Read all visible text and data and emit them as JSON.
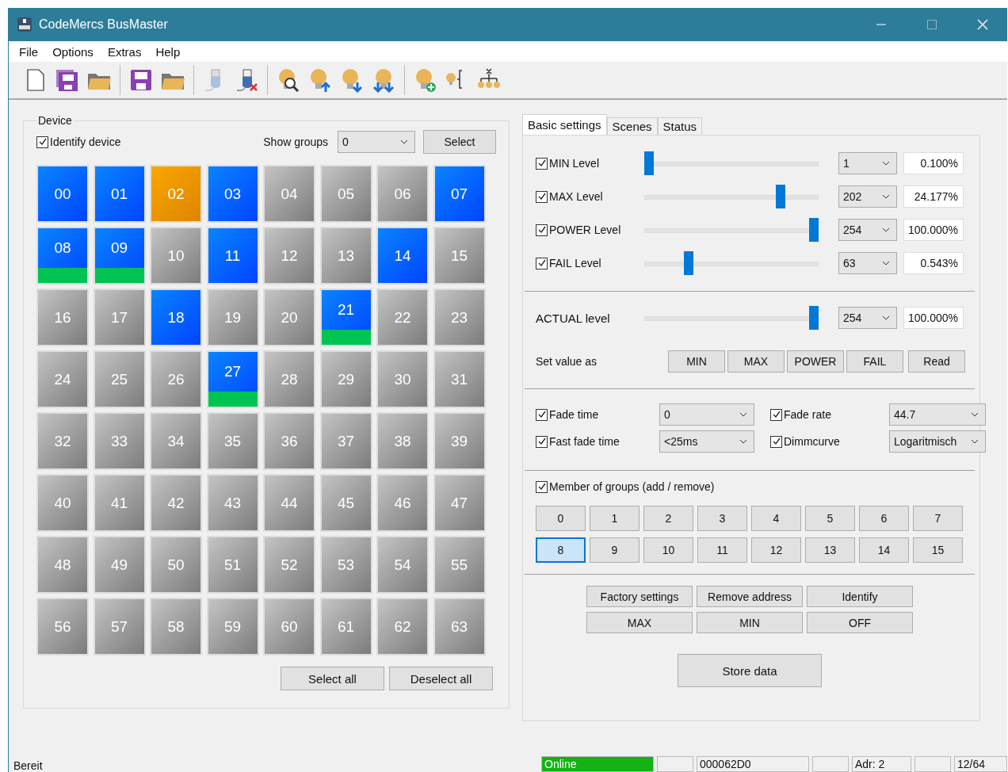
{
  "window": {
    "title": "CodeMercs BusMaster"
  },
  "menu": [
    "File",
    "Options",
    "Extras",
    "Help"
  ],
  "device_panel": {
    "title": "Device",
    "identify": {
      "label": "Identify device",
      "checked": true
    },
    "show_groups_label": "Show groups",
    "show_groups_value": "0",
    "select_button": "Select",
    "tiles": [
      {
        "label": "00",
        "online": true,
        "selected": false,
        "marked": false
      },
      {
        "label": "01",
        "online": true,
        "selected": false,
        "marked": false
      },
      {
        "label": "02",
        "online": true,
        "selected": true,
        "marked": false
      },
      {
        "label": "03",
        "online": true,
        "selected": false,
        "marked": false
      },
      {
        "label": "04",
        "online": false,
        "selected": false,
        "marked": false
      },
      {
        "label": "05",
        "online": false,
        "selected": false,
        "marked": false
      },
      {
        "label": "06",
        "online": false,
        "selected": false,
        "marked": false
      },
      {
        "label": "07",
        "online": true,
        "selected": false,
        "marked": false
      },
      {
        "label": "08",
        "online": true,
        "selected": false,
        "marked": true
      },
      {
        "label": "09",
        "online": true,
        "selected": false,
        "marked": true
      },
      {
        "label": "10",
        "online": false,
        "selected": false,
        "marked": false
      },
      {
        "label": "11",
        "online": true,
        "selected": false,
        "marked": false
      },
      {
        "label": "12",
        "online": false,
        "selected": false,
        "marked": false
      },
      {
        "label": "13",
        "online": false,
        "selected": false,
        "marked": false
      },
      {
        "label": "14",
        "online": true,
        "selected": false,
        "marked": false
      },
      {
        "label": "15",
        "online": false,
        "selected": false,
        "marked": false
      },
      {
        "label": "16",
        "online": false,
        "selected": false,
        "marked": false
      },
      {
        "label": "17",
        "online": false,
        "selected": false,
        "marked": false
      },
      {
        "label": "18",
        "online": true,
        "selected": false,
        "marked": false
      },
      {
        "label": "19",
        "online": false,
        "selected": false,
        "marked": false
      },
      {
        "label": "20",
        "online": false,
        "selected": false,
        "marked": false
      },
      {
        "label": "21",
        "online": true,
        "selected": false,
        "marked": true
      },
      {
        "label": "22",
        "online": false,
        "selected": false,
        "marked": false
      },
      {
        "label": "23",
        "online": false,
        "selected": false,
        "marked": false
      },
      {
        "label": "24",
        "online": false,
        "selected": false,
        "marked": false
      },
      {
        "label": "25",
        "online": false,
        "selected": false,
        "marked": false
      },
      {
        "label": "26",
        "online": false,
        "selected": false,
        "marked": false
      },
      {
        "label": "27",
        "online": true,
        "selected": false,
        "marked": true
      },
      {
        "label": "28",
        "online": false,
        "selected": false,
        "marked": false
      },
      {
        "label": "29",
        "online": false,
        "selected": false,
        "marked": false
      },
      {
        "label": "30",
        "online": false,
        "selected": false,
        "marked": false
      },
      {
        "label": "31",
        "online": false,
        "selected": false,
        "marked": false
      },
      {
        "label": "32",
        "online": false,
        "selected": false,
        "marked": false
      },
      {
        "label": "33",
        "online": false,
        "selected": false,
        "marked": false
      },
      {
        "label": "34",
        "online": false,
        "selected": false,
        "marked": false
      },
      {
        "label": "35",
        "online": false,
        "selected": false,
        "marked": false
      },
      {
        "label": "36",
        "online": false,
        "selected": false,
        "marked": false
      },
      {
        "label": "37",
        "online": false,
        "selected": false,
        "marked": false
      },
      {
        "label": "38",
        "online": false,
        "selected": false,
        "marked": false
      },
      {
        "label": "39",
        "online": false,
        "selected": false,
        "marked": false
      },
      {
        "label": "40",
        "online": false,
        "selected": false,
        "marked": false
      },
      {
        "label": "41",
        "online": false,
        "selected": false,
        "marked": false
      },
      {
        "label": "42",
        "online": false,
        "selected": false,
        "marked": false
      },
      {
        "label": "43",
        "online": false,
        "selected": false,
        "marked": false
      },
      {
        "label": "44",
        "online": false,
        "selected": false,
        "marked": false
      },
      {
        "label": "45",
        "online": false,
        "selected": false,
        "marked": false
      },
      {
        "label": "46",
        "online": false,
        "selected": false,
        "marked": false
      },
      {
        "label": "47",
        "online": false,
        "selected": false,
        "marked": false
      },
      {
        "label": "48",
        "online": false,
        "selected": false,
        "marked": false
      },
      {
        "label": "49",
        "online": false,
        "selected": false,
        "marked": false
      },
      {
        "label": "50",
        "online": false,
        "selected": false,
        "marked": false
      },
      {
        "label": "51",
        "online": false,
        "selected": false,
        "marked": false
      },
      {
        "label": "52",
        "online": false,
        "selected": false,
        "marked": false
      },
      {
        "label": "53",
        "online": false,
        "selected": false,
        "marked": false
      },
      {
        "label": "54",
        "online": false,
        "selected": false,
        "marked": false
      },
      {
        "label": "55",
        "online": false,
        "selected": false,
        "marked": false
      },
      {
        "label": "56",
        "online": false,
        "selected": false,
        "marked": false
      },
      {
        "label": "57",
        "online": false,
        "selected": false,
        "marked": false
      },
      {
        "label": "58",
        "online": false,
        "selected": false,
        "marked": false
      },
      {
        "label": "59",
        "online": false,
        "selected": false,
        "marked": false
      },
      {
        "label": "60",
        "online": false,
        "selected": false,
        "marked": false
      },
      {
        "label": "61",
        "online": false,
        "selected": false,
        "marked": false
      },
      {
        "label": "62",
        "online": false,
        "selected": false,
        "marked": false
      },
      {
        "label": "63",
        "online": false,
        "selected": false,
        "marked": false
      }
    ],
    "buttons": [
      "Select all",
      "Deselect all"
    ]
  },
  "tabs": [
    {
      "label": "Basic settings",
      "selected": true
    },
    {
      "label": "Scenes",
      "selected": false
    },
    {
      "label": "Status",
      "selected": false
    }
  ],
  "levels": [
    {
      "label": "MIN Level",
      "checked": true,
      "level": 0.0,
      "value": "1",
      "percent": "0.100%"
    },
    {
      "label": "MAX Level",
      "checked": true,
      "level": 0.8,
      "value": "202",
      "percent": "24.177%"
    },
    {
      "label": "POWER Level",
      "checked": true,
      "level": 1.0,
      "value": "254",
      "percent": "100.000%"
    },
    {
      "label": "FAIL Level",
      "checked": true,
      "level": 0.24,
      "value": "63",
      "percent": "0.543%"
    }
  ],
  "actual": {
    "label": "ACTUAL level",
    "level": 1.0,
    "value": "254",
    "percent": "100.000%"
  },
  "set_value": {
    "label": "Set value as",
    "buttons": [
      "MIN",
      "MAX",
      "POWER",
      "FAIL"
    ],
    "read_button": "Read"
  },
  "fade": [
    {
      "label": "Fade time",
      "checked": true,
      "value": "0"
    },
    {
      "label": "Fade rate",
      "checked": true,
      "value": "44.7"
    },
    {
      "label": "Fast fade time",
      "checked": true,
      "value": "<25ms"
    },
    {
      "label": "Dimmcurve",
      "checked": true,
      "value": "Logaritmisch"
    }
  ],
  "groups": {
    "label": "Member of groups (add / remove)",
    "checked": true,
    "items": [
      {
        "label": "0",
        "selected": false
      },
      {
        "label": "1",
        "selected": false
      },
      {
        "label": "2",
        "selected": false
      },
      {
        "label": "3",
        "selected": false
      },
      {
        "label": "4",
        "selected": false
      },
      {
        "label": "5",
        "selected": false
      },
      {
        "label": "6",
        "selected": false
      },
      {
        "label": "7",
        "selected": false
      },
      {
        "label": "8",
        "selected": true
      },
      {
        "label": "9",
        "selected": false
      },
      {
        "label": "10",
        "selected": false
      },
      {
        "label": "11",
        "selected": false
      },
      {
        "label": "12",
        "selected": false
      },
      {
        "label": "13",
        "selected": false
      },
      {
        "label": "14",
        "selected": false
      },
      {
        "label": "15",
        "selected": false
      }
    ]
  },
  "actions": [
    "Factory settings",
    "Remove address",
    "Identify",
    "MAX",
    "MIN",
    "OFF"
  ],
  "store_button": "Store data",
  "status_bar": {
    "text": "Bereit",
    "panels": [
      {
        "text": "Online",
        "kind": "online"
      },
      {
        "kind": "empty"
      },
      {
        "text": "000062D0",
        "kind": "plain"
      },
      {
        "kind": "empty"
      },
      {
        "text": "Adr: 2",
        "kind": "plain"
      },
      {
        "kind": "empty"
      },
      {
        "text": "12/64",
        "kind": "plain"
      }
    ]
  }
}
